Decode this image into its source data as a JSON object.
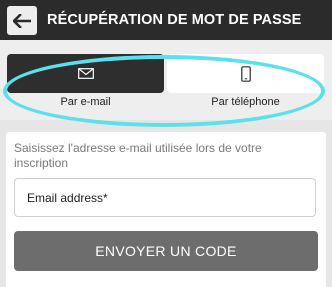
{
  "header": {
    "back_icon": "arrow-left-icon",
    "title": "RÉCUPÉRATION DE MOT DE PASSE"
  },
  "tabs": [
    {
      "icon": "envelope-icon",
      "label": "Par e-mail",
      "selected": true
    },
    {
      "icon": "smartphone-icon",
      "label": "Par téléphone",
      "selected": false
    }
  ],
  "form": {
    "instructions": "Saisissez l'adresse e-mail utilisée lors de votre inscription",
    "email_placeholder": "Email address*",
    "email_value": "",
    "submit_label": "ENVOYER UN CODE"
  },
  "colors": {
    "header_bg": "#2b2b2b",
    "selected_tab": "#2e2e2e",
    "button_bg": "#6d6d6d",
    "highlight": "#5ce0ec"
  }
}
